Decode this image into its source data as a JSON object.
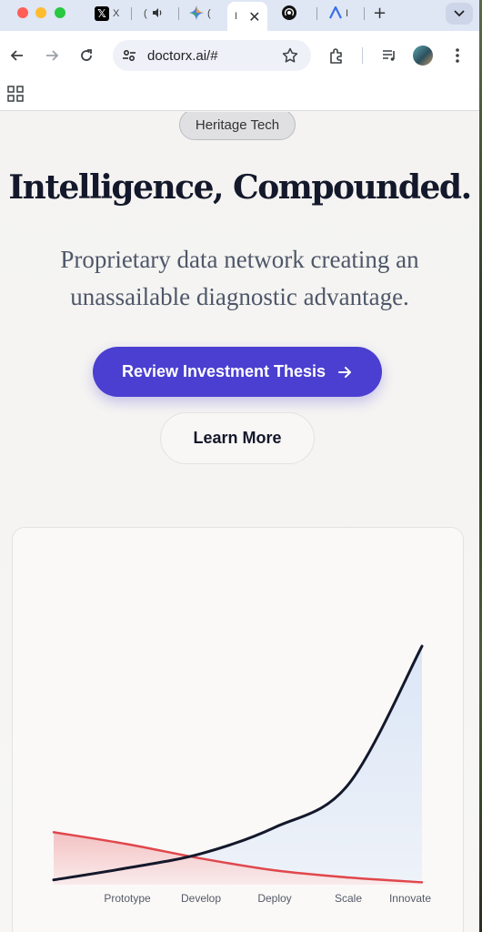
{
  "browser": {
    "tabs": [
      {
        "icon": "x-logo-icon",
        "title": "X"
      },
      {
        "icon": "speaker-icon",
        "title": "("
      },
      {
        "icon": "gemini-sparkle-icon",
        "title": "("
      },
      {
        "icon": "",
        "title": "I",
        "active": true
      },
      {
        "icon": "podcast-icon",
        "title": ""
      },
      {
        "icon": "a-logo-icon",
        "title": "I"
      }
    ],
    "url": "doctorx.ai/#"
  },
  "hero": {
    "badge": "Heritage Tech",
    "title": "Intelligence, Compounded.",
    "subtitle": "Proprietary data network creating an unassailable diagnostic advantage.",
    "primary_cta": "Review Investment Thesis",
    "secondary_cta": "Learn More"
  },
  "colors": {
    "accent": "#4a3fd0",
    "growth_line": "#14182b",
    "decline_line": "#e0474c"
  },
  "chart_data": {
    "type": "line",
    "categories": [
      "Prototype",
      "Develop",
      "Deploy",
      "Scale",
      "Innovate"
    ],
    "x": [
      0,
      1,
      2,
      3,
      4,
      5
    ],
    "series": [
      {
        "values": [
          2,
          7,
          13,
          24,
          42,
          100
        ]
      },
      {
        "values": [
          22,
          17,
          11,
          6,
          3,
          1
        ]
      }
    ],
    "ylim": [
      0,
      100
    ],
    "grid": false
  }
}
